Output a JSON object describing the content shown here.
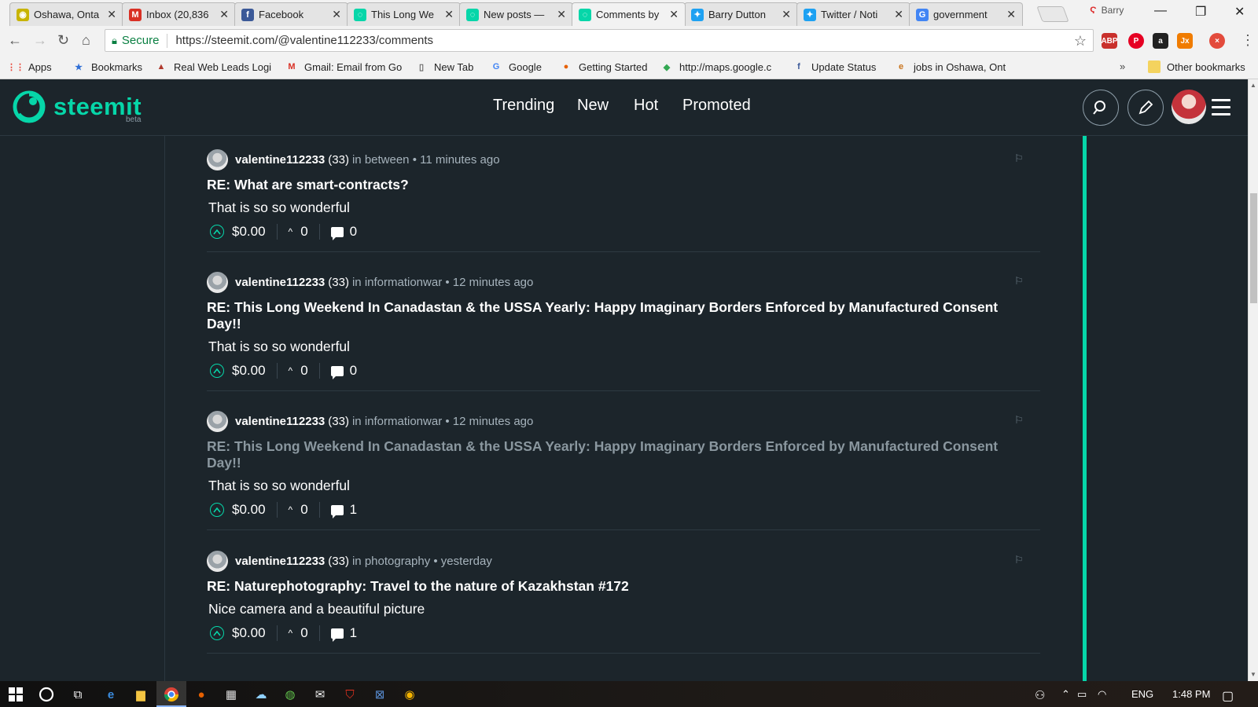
{
  "tabs": [
    {
      "title": "Oshawa, Onta",
      "color": "#c8b400",
      "glyph": "◉"
    },
    {
      "title": "Inbox (20,836",
      "color": "#d93025",
      "glyph": "M"
    },
    {
      "title": "Facebook",
      "color": "#3b5998",
      "glyph": "f"
    },
    {
      "title": "This Long We",
      "color": "#06d6a9",
      "glyph": "◌"
    },
    {
      "title": "New posts —",
      "color": "#06d6a9",
      "glyph": "◌"
    },
    {
      "title": "Comments by",
      "color": "#06d6a9",
      "glyph": "◌"
    },
    {
      "title": "Barry Dutton",
      "color": "#1da1f2",
      "glyph": "✦"
    },
    {
      "title": "Twitter / Noti",
      "color": "#1da1f2",
      "glyph": "✦"
    },
    {
      "title": "government",
      "color": "#4285f4",
      "glyph": "G"
    }
  ],
  "profile_name": "Barry",
  "address": {
    "secure_label": "Secure",
    "url": "https://steemit.com/@valentine112233/comments"
  },
  "bookmarks": [
    {
      "label": "Apps",
      "icon": "apps-icon",
      "color": "#e94235",
      "glyph": "⋮⋮"
    },
    {
      "label": "Bookmarks",
      "icon": "star-icon",
      "color": "#2f6fd6",
      "glyph": "★"
    },
    {
      "label": "Real Web Leads Logi",
      "icon": "leads-icon",
      "color": "#b03a2e",
      "glyph": "▲"
    },
    {
      "label": "Gmail: Email from Go",
      "icon": "gmail-icon",
      "color": "#d93025",
      "glyph": "M"
    },
    {
      "label": "New Tab",
      "icon": "page-icon",
      "color": "#666666",
      "glyph": "▯"
    },
    {
      "label": "Google",
      "icon": "google-icon",
      "color": "#4285f4",
      "glyph": "G"
    },
    {
      "label": "Getting Started",
      "icon": "firefox-icon",
      "color": "#e66000",
      "glyph": "●"
    },
    {
      "label": "http://maps.google.c",
      "icon": "maps-icon",
      "color": "#34a853",
      "glyph": "◆"
    },
    {
      "label": "Update Status",
      "icon": "facebook-icon",
      "color": "#3b5998",
      "glyph": "f"
    },
    {
      "label": "jobs in Oshawa, Ont",
      "icon": "ie-icon",
      "color": "#c9741d",
      "glyph": "e"
    }
  ],
  "overflow_chevron": "»",
  "other_bookmarks": "Other bookmarks",
  "brand": {
    "name": "steemit",
    "badge": "beta",
    "accent": "#06d6a9"
  },
  "nav": [
    "Trending",
    "New",
    "Hot",
    "Promoted"
  ],
  "comments": [
    {
      "author": "valentine112233",
      "reputation": "(33)",
      "in_label": "in",
      "category": "between",
      "time": "• 11 minutes ago",
      "title": "RE: What are smart-contracts?",
      "body": "That is so so wonderful",
      "payout": "$0.00",
      "votes": "0",
      "replies": "0",
      "muted": false
    },
    {
      "author": "valentine112233",
      "reputation": "(33)",
      "in_label": "in",
      "category": "informationwar",
      "time": "• 12 minutes ago",
      "title": "RE: This Long Weekend In Canadastan & the USSA Yearly: Happy Imaginary Borders Enforced by Manufactured Consent Day!!",
      "body": "That is so so wonderful",
      "payout": "$0.00",
      "votes": "0",
      "replies": "0",
      "muted": false
    },
    {
      "author": "valentine112233",
      "reputation": "(33)",
      "in_label": "in",
      "category": "informationwar",
      "time": "• 12 minutes ago",
      "title": "RE: This Long Weekend In Canadastan & the USSA Yearly: Happy Imaginary Borders Enforced by Manufactured Consent Day!!",
      "body": "That is so so wonderful",
      "payout": "$0.00",
      "votes": "0",
      "replies": "1",
      "muted": true
    },
    {
      "author": "valentine112233",
      "reputation": "(33)",
      "in_label": "in",
      "category": "photography",
      "time": "• yesterday",
      "title": "RE: Naturephotography: Travel to the nature of Kazakhstan #172",
      "body": "Nice camera and a beautiful picture",
      "payout": "$0.00",
      "votes": "0",
      "replies": "1",
      "muted": false
    }
  ],
  "taskbar": {
    "language": "ENG",
    "time": "1:48 PM"
  }
}
